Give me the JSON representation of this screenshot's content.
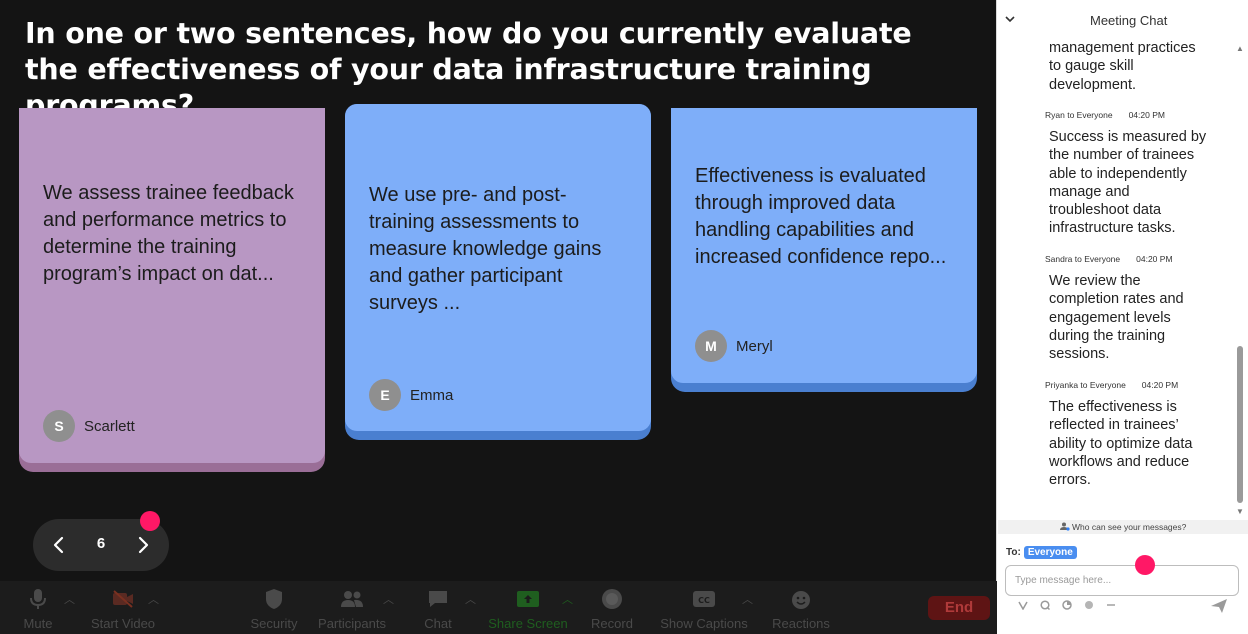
{
  "question": "In one or two sentences, how do you currently evaluate the effectiveness of your data infrastructure training programs?",
  "cards": [
    {
      "text": "We assess trainee feedback and performance metrics to determine the training program’s impact on dat...",
      "author": "Scarlett",
      "initial": "S",
      "color": "#b897c3"
    },
    {
      "text": "We use pre- and post-training assessments to measure knowledge gains and gather participant surveys ...",
      "author": "Emma",
      "initial": "E",
      "color": "#7eaef9"
    },
    {
      "text": "Effectiveness is evaluated through improved data handling capabilities and increased confidence repo...",
      "author": "Meryl",
      "initial": "M",
      "color": "#7eaef9"
    }
  ],
  "pager": {
    "page": "6",
    "prev_icon": "chevron-left-icon",
    "next_icon": "chevron-right-icon"
  },
  "toolbar": {
    "mute": "Mute",
    "start_video": "Start Video",
    "security": "Security",
    "participants": "Participants",
    "chat": "Chat",
    "share_screen": "Share Screen",
    "record": "Record",
    "show_captions": "Show Captions",
    "reactions": "Reactions",
    "end": "End"
  },
  "chat": {
    "title": "Meeting Chat",
    "messages": [
      {
        "sender": "",
        "time": "",
        "text": "management practices to gauge skill development."
      },
      {
        "sender": "Ryan to Everyone",
        "time": "04:20 PM",
        "text": "Success is measured by the number of trainees able to independently manage and troubleshoot data infrastructure tasks."
      },
      {
        "sender": "Sandra to Everyone",
        "time": "04:20 PM",
        "text": "We review the completion rates and engagement levels during the training sessions."
      },
      {
        "sender": "Priyanka to Everyone",
        "time": "04:20 PM",
        "text": "The effectiveness is reflected in trainees’ ability to optimize data workflows and reduce errors."
      }
    ],
    "who_can_see": "Who can see your messages?",
    "to_label": "To:",
    "to_value": "Everyone",
    "input_placeholder": "Type message here..."
  },
  "colors": {
    "accent_dot": "#ff1866",
    "stage_bg": "#141414",
    "badge": "#4a8ef0"
  }
}
